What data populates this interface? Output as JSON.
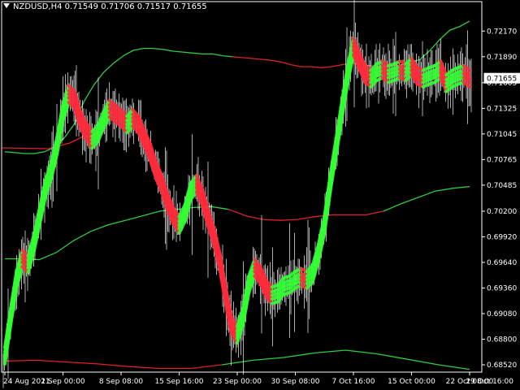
{
  "header": {
    "symbol": "NZDUSD,H4",
    "open": "0.71549",
    "high": "0.71706",
    "low": "0.71517",
    "close": "0.71655"
  },
  "colors": {
    "background": "#000000",
    "frame": "#ffffff",
    "bull": "#33ff33",
    "bear": "#ff2b3b",
    "band_upper": "#2ecc40",
    "band_mid_bear": "#e0202a",
    "band_mid_bull": "#2ecc40",
    "bars": "#ffffff"
  },
  "chart_data": {
    "type": "line",
    "title": "NZDUSD,H4",
    "ylim": [
      0.6844,
      0.7235
    ],
    "y_ticks": [
      "0.72170",
      "0.71890",
      "0.71605",
      "0.71325",
      "0.71045",
      "0.70765",
      "0.70485",
      "0.70200",
      "0.69920",
      "0.69640",
      "0.69360",
      "0.69080",
      "0.68800",
      "0.68520"
    ],
    "y_tick_values": [
      0.7217,
      0.7189,
      0.71605,
      0.71325,
      0.71045,
      0.70765,
      0.70485,
      0.702,
      0.6992,
      0.6964,
      0.6936,
      0.6908,
      0.688,
      0.6852
    ],
    "x_ticks": [
      "24 Aug 2021",
      "1 Sep 00:00",
      "8 Sep 08:00",
      "15 Sep 16:00",
      "23 Sep 00:00",
      "30 Sep 08:00",
      "7 Oct 16:00",
      "15 Oct 00:00",
      "22 Oct 08:00",
      "29 Oct 16:00"
    ],
    "x_tick_index": [
      0,
      10,
      20,
      30,
      40,
      50,
      60,
      70,
      80,
      90
    ],
    "current_price": "0.71655",
    "current_price_value": 0.71655,
    "grid": false,
    "series": [
      {
        "role": "price",
        "values": [
          0.6862,
          0.6905,
          0.6945,
          0.6968,
          0.6962,
          0.6985,
          0.7015,
          0.7045,
          0.7065,
          0.7092,
          0.7128,
          0.7148,
          0.7142,
          0.712,
          0.7108,
          0.7098,
          0.7105,
          0.712,
          0.7132,
          0.7127,
          0.7122,
          0.7115,
          0.7122,
          0.7115,
          0.71,
          0.7085,
          0.7065,
          0.705,
          0.703,
          0.7015,
          0.7005,
          0.7018,
          0.7042,
          0.705,
          0.7035,
          0.7012,
          0.6992,
          0.6965,
          0.6928,
          0.6895,
          0.6885,
          0.6905,
          0.694,
          0.6958,
          0.695,
          0.6935,
          0.6928,
          0.693,
          0.6938,
          0.694,
          0.6945,
          0.6948,
          0.6945,
          0.6952,
          0.6975,
          0.7005,
          0.705,
          0.709,
          0.713,
          0.717,
          0.72,
          0.7185,
          0.717,
          0.7165,
          0.7172,
          0.7175,
          0.717,
          0.7172,
          0.7175,
          0.7172,
          0.7178,
          0.7168,
          0.7165,
          0.7168,
          0.717,
          0.7175,
          0.716,
          0.7165,
          0.7168,
          0.717,
          0.7165
        ]
      },
      {
        "role": "upper-band",
        "values": [
          0.7085,
          0.7084,
          0.7083,
          0.7083,
          0.7085,
          0.709,
          0.71,
          0.7115,
          0.714,
          0.7158,
          0.7172,
          0.7182,
          0.719,
          0.7196,
          0.7198,
          0.7198,
          0.7197,
          0.7195,
          0.7194,
          0.7193,
          0.7192,
          0.7192,
          0.719,
          0.7189,
          0.7188,
          0.7187,
          0.7186,
          0.7185,
          0.7183,
          0.718,
          0.7178,
          0.7178,
          0.7177,
          0.7178,
          0.718,
          0.7182,
          0.7181,
          0.7179,
          0.7178,
          0.7179,
          0.718,
          0.7182,
          0.7186,
          0.7196,
          0.7208,
          0.7218,
          0.7222,
          0.7228
        ]
      },
      {
        "role": "middle-band",
        "values": [
          0.6968,
          0.6968,
          0.6967,
          0.6975,
          0.6988,
          0.6998,
          0.7005,
          0.701,
          0.7015,
          0.702,
          0.7022,
          0.7024,
          0.7025,
          0.7022,
          0.7015,
          0.7011,
          0.701,
          0.7011,
          0.7014,
          0.7016,
          0.7016,
          0.7016,
          0.702,
          0.7028,
          0.7035,
          0.7042,
          0.7045,
          0.7047
        ]
      },
      {
        "role": "lower-band",
        "values": [
          0.6856,
          0.6857,
          0.6855,
          0.6853,
          0.685,
          0.6848,
          0.6848,
          0.6852,
          0.6857,
          0.686,
          0.6865,
          0.6868,
          0.6864,
          0.6858,
          0.6852,
          0.6847
        ]
      }
    ]
  }
}
